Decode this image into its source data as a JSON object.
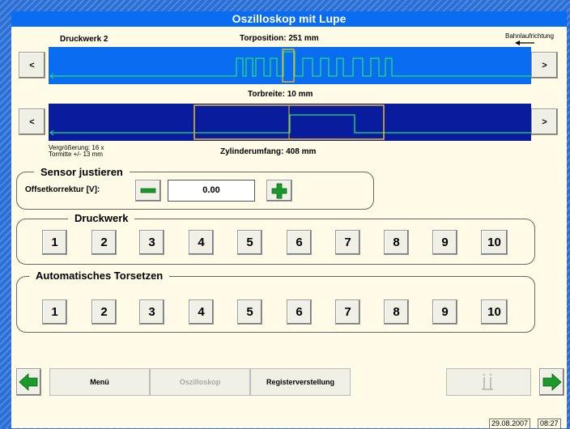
{
  "title": "Oszilloskop  mit Lupe",
  "header": {
    "druckwerk": "Druckwerk 2",
    "torposition": "Torposition: 251  mm",
    "bahnlauf": "Bahnlaufrichtung"
  },
  "scope1": {
    "left_label": "<",
    "right_label": ">"
  },
  "torbreite": "Torbreite: 10  mm",
  "scope2": {
    "left_label": "<",
    "right_label": ">"
  },
  "vergroesserung": "Vergrößerung: 16 x",
  "tormitte": "Tormitte +/- 13  mm",
  "zylinderumfang": "Zylinderumfang: 408  mm",
  "sensor": {
    "title": "Sensor justieren",
    "offset_label": "Offsetkorrektur [V]:",
    "value": "0.00"
  },
  "druckwerk_group": {
    "title": "Druckwerk",
    "buttons": [
      "1",
      "2",
      "3",
      "4",
      "5",
      "6",
      "7",
      "8",
      "9",
      "10"
    ]
  },
  "auto_group": {
    "title": "Automatisches Torsetzen",
    "buttons": [
      "1",
      "2",
      "3",
      "4",
      "5",
      "6",
      "7",
      "8",
      "9",
      "10"
    ]
  },
  "bottom": {
    "menu": "Menü",
    "oszilloskop": "Oszilloskop",
    "register": "Registerverstellung"
  },
  "status": {
    "date": "29.08.2007",
    "time": "08:27"
  },
  "colors": {
    "title_blue": "#0a6cf0",
    "track_dark": "#0a1c9e",
    "signal": "#20e070",
    "gate": "#f0c020"
  }
}
